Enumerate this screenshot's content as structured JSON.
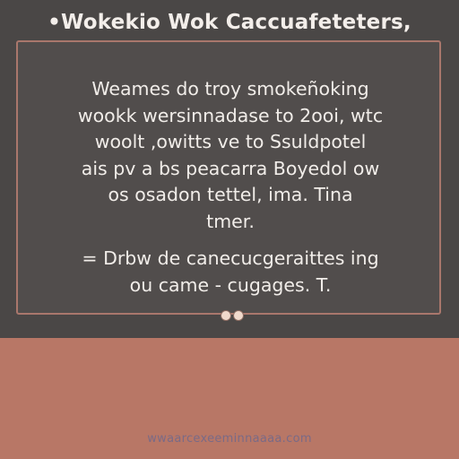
{
  "header": {
    "title": "•Wokekio Wok Caccuafeteters,"
  },
  "card": {
    "paragraph_1": [
      "Weames do troy smokeñoking",
      "wookk wersinnadase to 2ooi, wtc",
      "woolt ,owitts ve to Ssuldpotel",
      "ais pv a bs peacarra Boyedol ow",
      "os osadon tettel, ima. Tina",
      "tmer."
    ],
    "paragraph_2": [
      "= Drbw de canecucgeraittes ing",
      "ou came - cugages. T."
    ]
  },
  "pager": {
    "dot_count": 2
  },
  "footer": {
    "link_text": "wwaarcexeeminnaaaa.com"
  },
  "colors": {
    "background": "#4a4746",
    "card_border": "#a9776c",
    "bottom_band": "#b87766",
    "text": "#f1ede9",
    "link": "#7a6a86"
  }
}
